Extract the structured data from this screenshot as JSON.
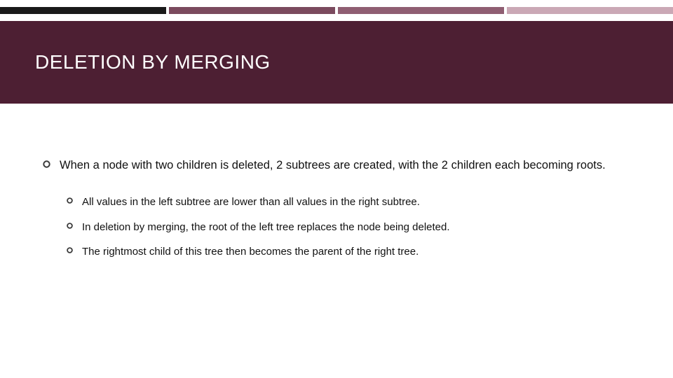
{
  "title": "DELETION BY MERGING",
  "main_bullet": "When a node with two children is deleted, 2 subtrees are created, with the 2 children each becoming roots.",
  "sub_bullets": [
    "All values in the left subtree are lower than all values in the right subtree.",
    "In deletion by merging, the root of the left tree replaces the node being deleted.",
    "The rightmost child of this tree then becomes the parent of the right tree."
  ],
  "colors": {
    "band": "#4d1f33",
    "accent1": "#1a1a1a",
    "accent2": "#7b4a5e",
    "accent3": "#8f5e72",
    "accent4": "#caa8b5"
  }
}
